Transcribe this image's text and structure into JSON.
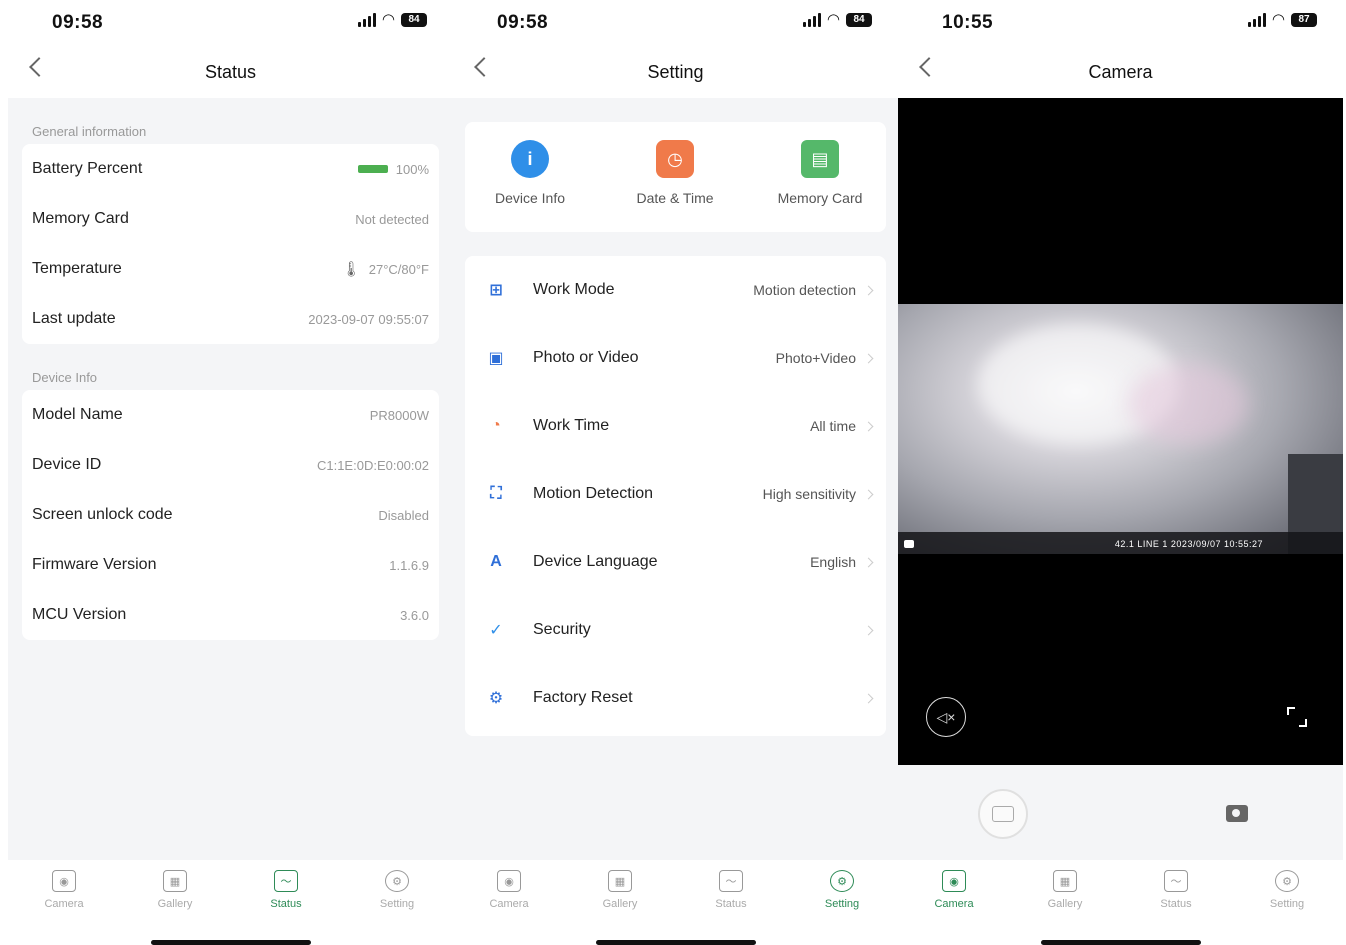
{
  "status_screen": {
    "time": "09:58",
    "battery": "84",
    "title": "Status",
    "general_label": "General information",
    "general_rows": [
      {
        "label": "Battery Percent",
        "value": "100%"
      },
      {
        "label": "Memory Card",
        "value": "Not detected"
      },
      {
        "label": "Temperature",
        "value": "27°C/80°F"
      },
      {
        "label": "Last update",
        "value": "2023-09-07 09:55:07"
      }
    ],
    "device_label": "Device Info",
    "device_rows": [
      {
        "label": "Model Name",
        "value": "PR8000W"
      },
      {
        "label": "Device ID",
        "value": "C1:1E:0D:E0:00:02"
      },
      {
        "label": "Screen unlock code",
        "value": "Disabled"
      },
      {
        "label": "Firmware Version",
        "value": "1.1.6.9"
      },
      {
        "label": "MCU Version",
        "value": "3.6.0"
      }
    ]
  },
  "setting_screen": {
    "time": "09:58",
    "battery": "84",
    "title": "Setting",
    "quick_items": [
      {
        "label": "Device Info",
        "icon": "info-icon",
        "glyph": "i",
        "color": "#2f8fe8"
      },
      {
        "label": "Date & Time",
        "icon": "clock-icon",
        "glyph": "◷",
        "color": "#f07a4a"
      },
      {
        "label": "Memory Card",
        "icon": "sd-card-icon",
        "glyph": "▤",
        "color": "#55b86a"
      }
    ],
    "rows": [
      {
        "label": "Work Mode",
        "value": "Motion detection",
        "icon": "grid-icon",
        "glyph": "⊞",
        "color": "#2f6fd8"
      },
      {
        "label": "Photo or Video",
        "value": "Photo+Video",
        "icon": "camera-video-icon",
        "glyph": "▣",
        "color": "#2f6fd8"
      },
      {
        "label": "Work Time",
        "value": "All time",
        "icon": "timer-icon",
        "glyph": "◔",
        "color": "#f07a4a"
      },
      {
        "label": "Motion Detection",
        "value": "High sensitivity",
        "icon": "motion-icon",
        "glyph": "⛶",
        "color": "#2f6fd8"
      },
      {
        "label": "Device Language",
        "value": "English",
        "icon": "language-icon",
        "glyph": "A",
        "color": "#2f6fd8"
      },
      {
        "label": "Security",
        "value": "",
        "icon": "shield-icon",
        "glyph": "✓",
        "color": "#2f8fe8"
      },
      {
        "label": "Factory Reset",
        "value": "",
        "icon": "gear-icon",
        "glyph": "⚙",
        "color": "#2f6fd8"
      }
    ]
  },
  "camera_screen": {
    "time": "10:55",
    "battery": "87",
    "title": "Camera",
    "overlay": "42.1 LINE 1 2023/09/07 10:55:27"
  },
  "tabs": [
    {
      "label": "Camera",
      "icon": "camera-icon"
    },
    {
      "label": "Gallery",
      "icon": "gallery-icon"
    },
    {
      "label": "Status",
      "icon": "status-icon"
    },
    {
      "label": "Setting",
      "icon": "setting-icon"
    }
  ],
  "colors": {
    "accent": "#2e8b57",
    "battery_green": "#4caf50"
  }
}
